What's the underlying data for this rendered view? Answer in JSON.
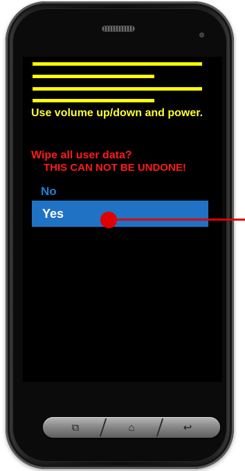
{
  "recovery_screen": {
    "instruction_text": "Use volume up/down and power.",
    "warning_title": "Wipe all user data?",
    "warning_subtitle": "THIS CAN NOT BE UNDONE!",
    "options": [
      {
        "label": "No",
        "selected": false
      },
      {
        "label": "Yes",
        "selected": true
      }
    ]
  },
  "nav_keys": [
    {
      "icon": "recent-apps-icon",
      "glyph": "⧉"
    },
    {
      "icon": "home-icon",
      "glyph": "⌂"
    },
    {
      "icon": "back-icon",
      "glyph": "↩"
    }
  ],
  "colors": {
    "header_bars": "#ffff00",
    "instruction_text": "#ffff33",
    "warning_text": "#ff1a1a",
    "option_no_text": "#1f7fd6",
    "option_yes_highlight": "#1f72c4",
    "callout_marker": "#e00000",
    "screen_background": "#000000"
  }
}
